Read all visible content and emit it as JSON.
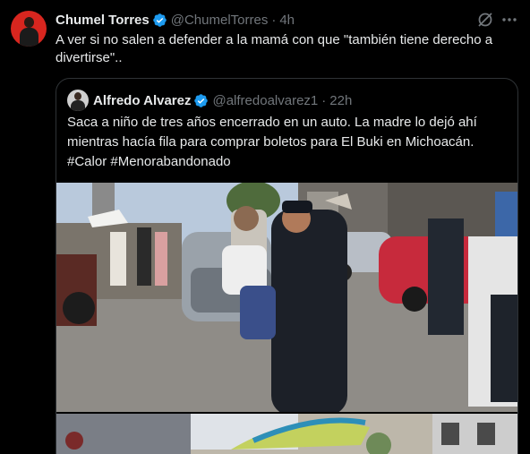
{
  "tweet": {
    "author_name": "Chumel Torres",
    "author_handle": "@ChumelTorres",
    "separator": "·",
    "time": "4h",
    "text": "A ver si no salen a defender a la mamá con que \"también tiene derecho a divertirse\"..",
    "icons": [
      "grok-icon",
      "more-icon",
      "verified-icon"
    ]
  },
  "quote": {
    "author_name": "Alfredo Alvarez",
    "author_handle": "@alfredoalvarez1",
    "separator": "·",
    "time": "22h",
    "text": "Saca a niño de tres años encerrado en un auto. La madre lo dejó ahí mientras hacía fila para comprar boletos para El Buki en Michoacán. #Calor #Menorabandonado"
  },
  "colors": {
    "background": "#000000",
    "text_primary": "#e7e9ea",
    "text_secondary": "#71767b",
    "verified_blue": "#1d9bf0",
    "border": "#2f3336"
  }
}
